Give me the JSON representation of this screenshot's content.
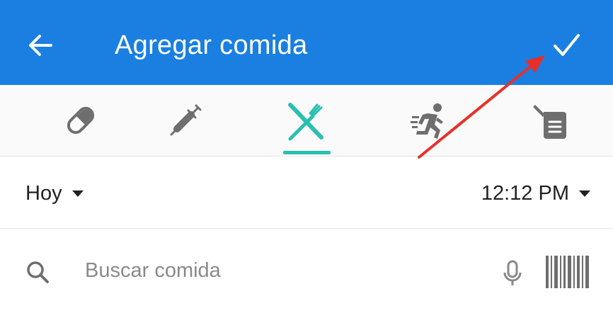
{
  "app_bar": {
    "title": "Agregar comida",
    "back_icon": "arrow-left-icon",
    "confirm_icon": "check-icon",
    "color": "#1a7fe0"
  },
  "tabs": [
    {
      "name": "medication",
      "icon": "pill-icon",
      "selected": false
    },
    {
      "name": "insulin",
      "icon": "syringe-icon",
      "selected": false
    },
    {
      "name": "food",
      "icon": "fork-knife-icon",
      "selected": true
    },
    {
      "name": "exercise",
      "icon": "running-icon",
      "selected": false
    },
    {
      "name": "notes",
      "icon": "note-tag-icon",
      "selected": false
    }
  ],
  "accent_color": "#2abfb0",
  "date_selector": {
    "value": "Hoy"
  },
  "time_selector": {
    "value": "12:12 PM"
  },
  "search": {
    "placeholder": "Buscar comida",
    "value": ""
  },
  "annotation": {
    "type": "red-arrow",
    "points_to": "check-icon",
    "color": "#e8302a"
  }
}
